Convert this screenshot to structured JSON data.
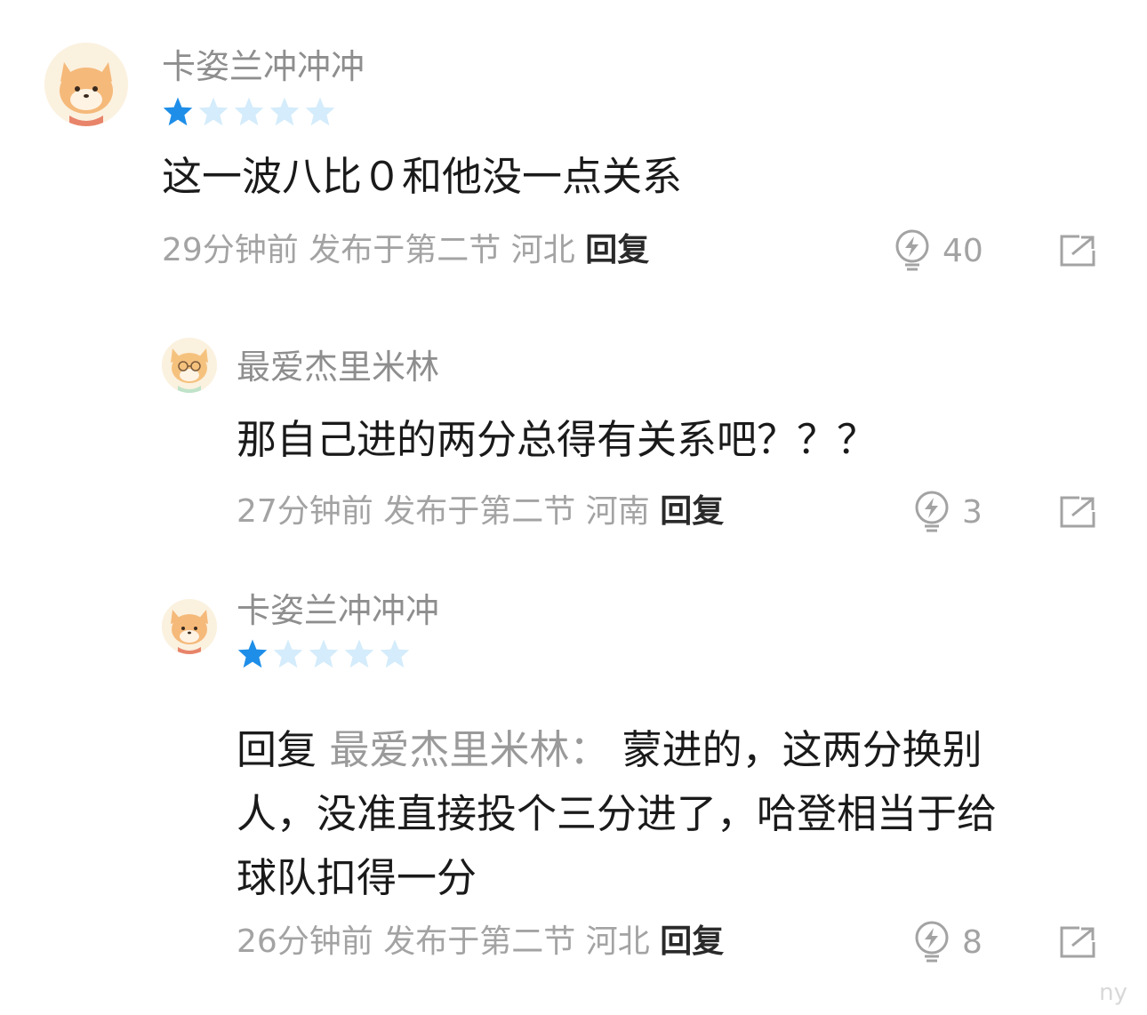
{
  "colors": {
    "username": "#8e8e8e",
    "meta": "#a3a3a3",
    "reply": "#2a2a2a",
    "star_filled": "#1e8ee8",
    "star_empty": "#d4ecfb",
    "avatar_bg": "#fbf1df",
    "avatar_fox": "#f5b97a"
  },
  "comments": [
    {
      "username": "卡姿兰冲冲冲",
      "avatar_icon": "fox-avatar-icon",
      "rating": 1,
      "rating_max": 5,
      "text": "这一波八比０和他没一点关系",
      "time": "29分钟前",
      "posted_in": "发布于第二节",
      "location": "河北",
      "reply_label": "回复",
      "likes": "40",
      "like_icon": "lightning-bulb-icon",
      "share_icon": "share-arrow-icon"
    },
    {
      "username": "最爱杰里米林",
      "avatar_icon": "fox-glasses-avatar-icon",
      "text": "那自己进的两分总得有关系吧？？？",
      "time": "27分钟前",
      "posted_in": "发布于第二节",
      "location": "河南",
      "reply_label": "回复",
      "likes": "3",
      "like_icon": "lightning-bulb-icon",
      "share_icon": "share-arrow-icon"
    },
    {
      "username": "卡姿兰冲冲冲",
      "avatar_icon": "fox-avatar-icon",
      "rating": 1,
      "rating_max": 5,
      "reply_prefix": "回复",
      "reply_target": "最爱杰里米林：",
      "text_line1": "蒙进的，这两分换别",
      "text_line2": "人，没准直接投个三分进了，哈登相当于给",
      "text_line3": "球队扣得一分",
      "time": "26分钟前",
      "posted_in": "发布于第二节",
      "location": "河北",
      "reply_label": "回复",
      "likes": "8",
      "like_icon": "lightning-bulb-icon",
      "share_icon": "share-arrow-icon"
    }
  ],
  "watermark": "ny"
}
